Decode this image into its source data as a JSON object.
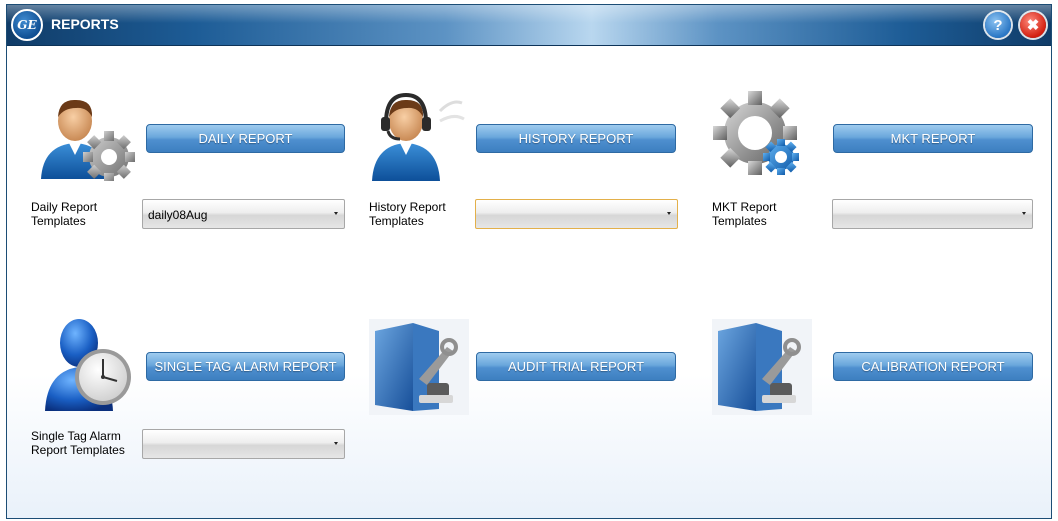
{
  "window": {
    "title": "REPORTS",
    "logo_icon": "ge-logo-icon",
    "help_label": "?",
    "close_label": "✖"
  },
  "reports": {
    "daily": {
      "button_label": "DAILY REPORT",
      "templates_label": "Daily Report Templates",
      "selected_template": "daily08Aug",
      "icon": "user-gear-icon"
    },
    "history": {
      "button_label": "HISTORY REPORT",
      "templates_label": "History Report Templates",
      "selected_template": "",
      "icon": "user-headset-icon"
    },
    "mkt": {
      "button_label": "MKT REPORT",
      "templates_label": "MKT Report Templates",
      "selected_template": "",
      "icon": "gears-icon"
    },
    "single_tag_alarm": {
      "button_label": "SINGLE TAG ALARM REPORT",
      "templates_label": "Single Tag Alarm Report Templates",
      "selected_template": "",
      "icon": "user-clock-icon"
    },
    "audit_trial": {
      "button_label": "AUDIT TRIAL REPORT",
      "icon": "folder-tools-icon"
    },
    "calibration": {
      "button_label": "CALIBRATION REPORT",
      "icon": "folder-tools-icon"
    }
  },
  "colors": {
    "title_bar": "#1d5c96",
    "button_blue": "#4e8fcf",
    "focus_border": "#e3b04a"
  }
}
